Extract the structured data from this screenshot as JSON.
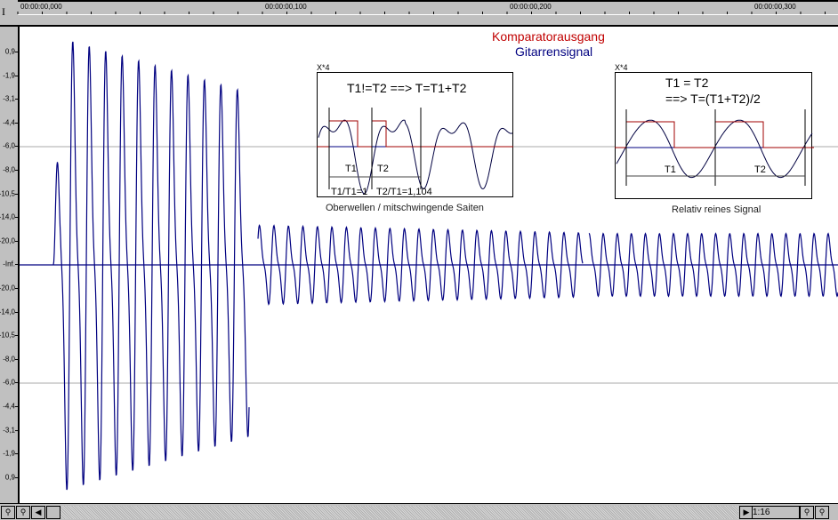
{
  "ruler": {
    "ticks": [
      "00:00:00,000",
      "00:00:00,100",
      "00:00:00,200",
      "00:00:00,300"
    ]
  },
  "axis": {
    "labels": [
      "0,9",
      "-1,9",
      "-3,1",
      "-4,4",
      "-6,0",
      "-8,0",
      "-10,5",
      "-14,0",
      "-20,0",
      "-Inf.",
      "-20,0",
      "-14,0",
      "-10,5",
      "-8,0",
      "-6,0",
      "-4,4",
      "-3,1",
      "-1,9",
      "0,9"
    ]
  },
  "legend": {
    "comparator": "Komparatorausgang",
    "guitar": "Gitarrensignal",
    "comparator_color": "#c00000",
    "guitar_color": "#000080"
  },
  "inset_left": {
    "scale": "X*4",
    "formula": "T1!=T2 ==> T=T1+T2",
    "t1": "T1",
    "t2": "T2",
    "ratio1": "T1/T1=1",
    "ratio2": "T2/T1=1,104",
    "caption": "Oberwellen / mitschwingende Saiten"
  },
  "inset_right": {
    "scale": "X*4",
    "formula1": "T1 = T2",
    "formula2": "==> T=(T1+T2)/2",
    "t1": "T1",
    "t2": "T2",
    "caption": "Relativ reines Signal"
  },
  "statusbar": {
    "zoom": "1:16"
  }
}
